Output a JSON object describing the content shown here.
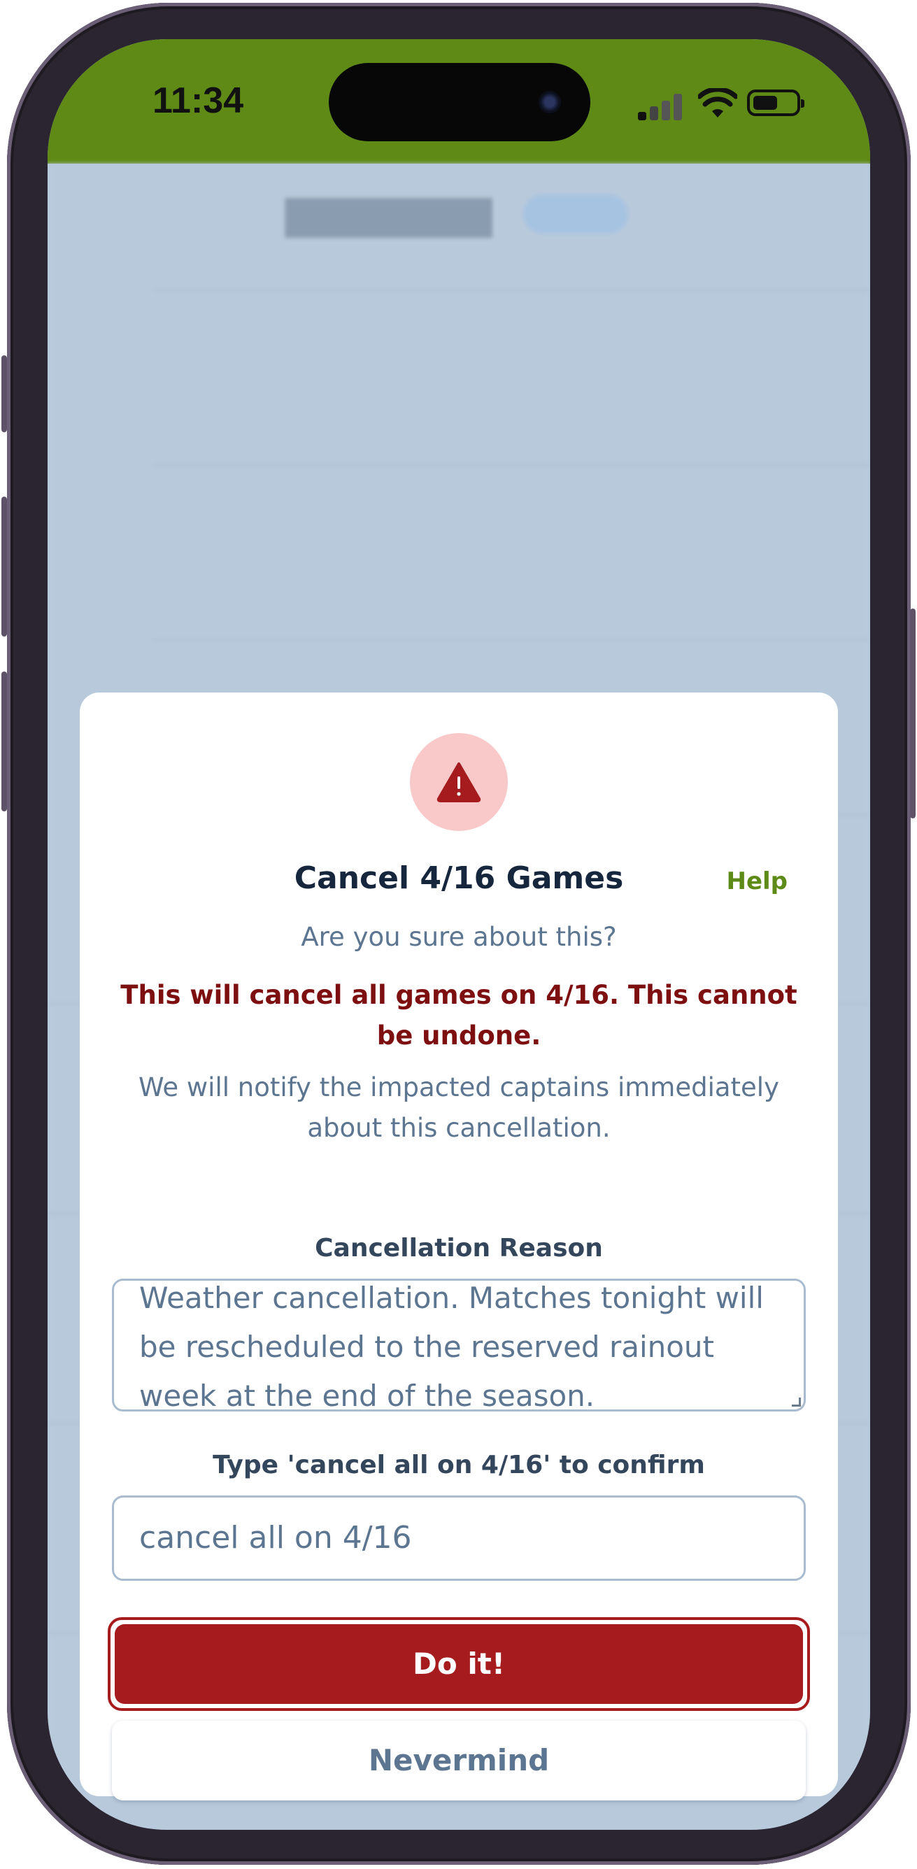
{
  "status_bar": {
    "time": "11:34"
  },
  "modal": {
    "title": "Cancel 4/16 Games",
    "help_label": "Help",
    "subtitle": "Are you sure about this?",
    "warning": "This will cancel all games on 4/16. This cannot be undone.",
    "notice": "We will notify the impacted captains immediately about this cancellation.",
    "reason_label": "Cancellation Reason",
    "reason_value": "Weather cancellation. Matches tonight will be rescheduled to the reserved rainout week at the end of the season.",
    "confirm_label": "Type 'cancel all on 4/16' to confirm",
    "confirm_value": "cancel all on 4/16",
    "confirm_button": "Do it!",
    "cancel_button": "Nevermind"
  },
  "colors": {
    "status_bar": "#5f8a16",
    "danger": "#a51b1e",
    "danger_text": "#7d0f10",
    "help": "#5e8a18",
    "icon_bg": "#f9c9c9"
  },
  "icons": {
    "warning": "warning-triangle-icon",
    "signal": "cellular-signal-icon",
    "wifi": "wifi-icon",
    "battery": "battery-icon"
  }
}
